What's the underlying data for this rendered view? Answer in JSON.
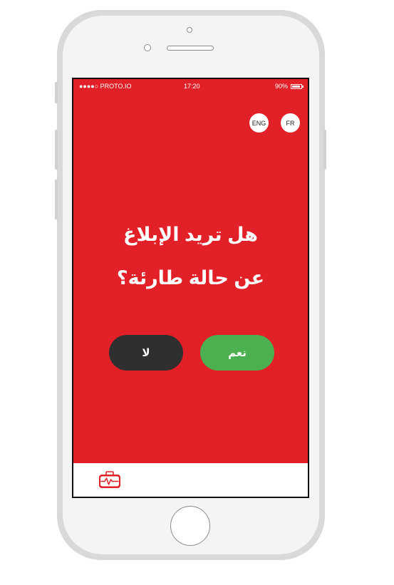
{
  "status_bar": {
    "carrier": "●●●●○ PROTO.IO",
    "time": "17:20",
    "battery": "90%"
  },
  "languages": [
    {
      "label": "ENG"
    },
    {
      "label": "FR"
    }
  ],
  "question": {
    "line1": "هل تريد الإبلاغ",
    "line2": "عن حالة طارئة؟"
  },
  "buttons": {
    "no_label": "لا",
    "yes_label": "نعم"
  },
  "tab_bar": {
    "icon": "medical-kit-icon"
  },
  "colors": {
    "screen_bg": "#e22027",
    "yes": "#4cb050",
    "no": "#2f2f2f"
  }
}
